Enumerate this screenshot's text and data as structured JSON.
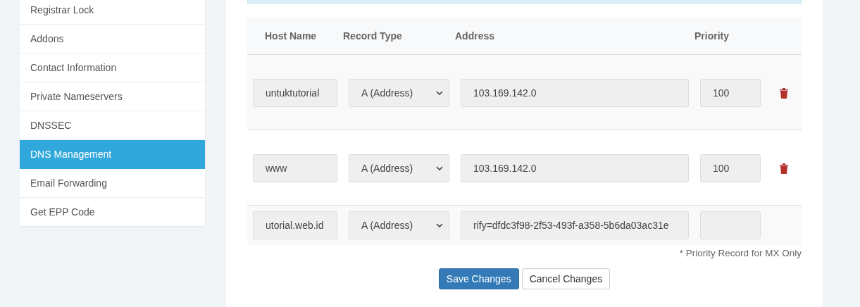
{
  "sidebar": {
    "items": [
      {
        "label": "Registrar Lock",
        "selected": false
      },
      {
        "label": "Addons",
        "selected": false
      },
      {
        "label": "Contact Information",
        "selected": false
      },
      {
        "label": "Private Nameservers",
        "selected": false
      },
      {
        "label": "DNSSEC",
        "selected": false
      },
      {
        "label": "DNS Management",
        "selected": true
      },
      {
        "label": "Email Forwarding",
        "selected": false
      },
      {
        "label": "Get EPP Code",
        "selected": false
      }
    ]
  },
  "table": {
    "columns": [
      "Host Name",
      "Record Type",
      "Address",
      "Priority"
    ],
    "rows": [
      {
        "host": "untuktutorial",
        "type": "A (Address)",
        "address": "103.169.142.0",
        "priority": "100",
        "deletable": true
      },
      {
        "host": "www",
        "type": "A (Address)",
        "address": "103.169.142.0",
        "priority": "100",
        "deletable": true
      },
      {
        "host": "utorial.web.id",
        "type": "A (Address)",
        "address": "rify=dfdc3f98-2f53-493f-a358-5b6da03ac31e",
        "deletable": false
      }
    ]
  },
  "note": "* Priority Record for MX Only",
  "buttons": [
    {
      "label": "Save Changes",
      "kind": "primary"
    },
    {
      "label": "Cancel Changes",
      "kind": "default"
    }
  ]
}
